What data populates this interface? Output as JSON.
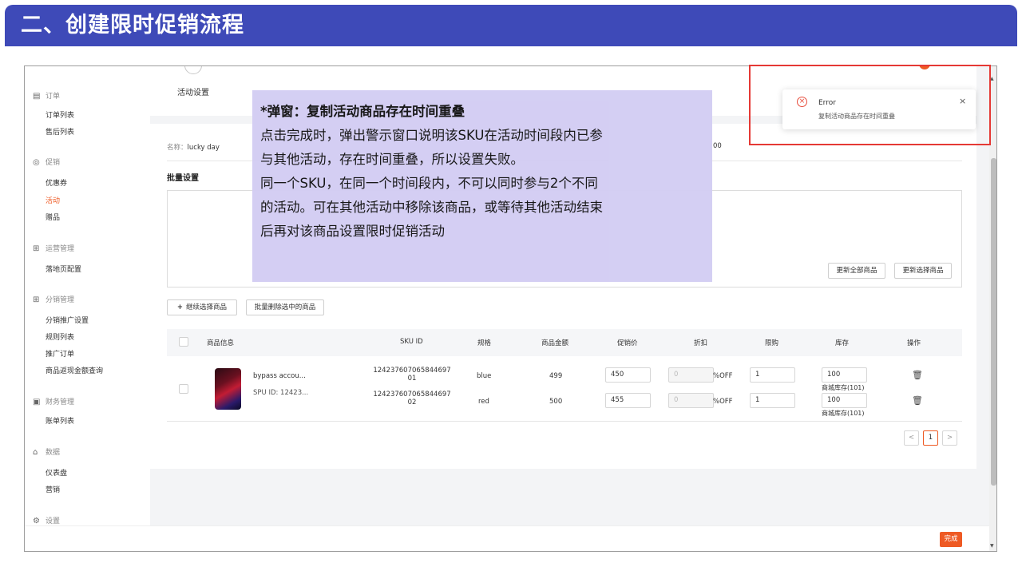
{
  "slide": {
    "title": "二、创建限时促销流程"
  },
  "sidebar": {
    "groups": [
      {
        "label": "订单",
        "icon": "clipboard-icon",
        "items": [
          {
            "label": "订单列表"
          },
          {
            "label": "售后列表"
          }
        ]
      },
      {
        "label": "促销",
        "icon": "tag-icon",
        "items": [
          {
            "label": "优惠券"
          },
          {
            "label": "活动",
            "active": true
          },
          {
            "label": "赠品"
          }
        ]
      },
      {
        "label": "运营管理",
        "icon": "grid-icon",
        "items": [
          {
            "label": "落地页配置"
          }
        ]
      },
      {
        "label": "分销管理",
        "icon": "grid-icon",
        "items": [
          {
            "label": "分销推广设置"
          },
          {
            "label": "规则列表"
          },
          {
            "label": "推广订单"
          },
          {
            "label": "商品返现金额查询"
          }
        ]
      },
      {
        "label": "财务管理",
        "icon": "ledger-icon",
        "items": [
          {
            "label": "账单列表"
          }
        ]
      },
      {
        "label": "数据",
        "icon": "chart-icon",
        "items": [
          {
            "label": "仪表盘"
          },
          {
            "label": "营销"
          }
        ]
      },
      {
        "label": "设置",
        "icon": "gear-icon",
        "items": []
      }
    ]
  },
  "steps": {
    "first": "活动设置"
  },
  "form": {
    "name_label": "名称：",
    "name_value": "lucky day",
    "name_tail": "00",
    "batch_title": "批量设置",
    "update_all": "更新全部商品",
    "update_selected": "更新选择商品",
    "continue_select": "继续选择商品",
    "batch_delete": "批量删除选中的商品"
  },
  "table": {
    "headers": [
      "商品信息",
      "SKU ID",
      "规格",
      "商品金额",
      "促销价",
      "折扣",
      "限购",
      "库存",
      "操作"
    ],
    "product": {
      "name": "bypass accou...",
      "spu": "SPU ID: 12423..."
    },
    "rows": [
      {
        "sku_line1": "124237607065844697",
        "sku_line2": "01",
        "spec": "blue",
        "price": "499",
        "promo_price": "450",
        "discount": "0",
        "discount_unit": "%OFF",
        "limit": "1",
        "stock": "100",
        "stock_note": "商城库存(101)"
      },
      {
        "sku_line1": "124237607065844697",
        "sku_line2": "02",
        "spec": "red",
        "price": "500",
        "promo_price": "455",
        "discount": "0",
        "discount_unit": "%OFF",
        "limit": "1",
        "stock": "100",
        "stock_note": "商城库存(101)"
      }
    ]
  },
  "pagination": {
    "prev": "<",
    "current": "1",
    "next": ">"
  },
  "footer": {
    "done": "完成"
  },
  "toast": {
    "title": "Error",
    "message": "复制活动商品存在时间重叠",
    "close": "×",
    "icon": "error-circle-icon",
    "color": "#e74c3c"
  },
  "callout": {
    "title": "*弹窗：复制活动商品存在时间重叠",
    "lines": [
      "点击完成时，弹出警示窗口说明该SKU在活动时间段内已参",
      "与其他活动，存在时间重叠，所以设置失败。",
      "同一个SKU，在同一个时间段内，不可以同时参与2个不同",
      "的活动。可在其他活动中移除该商品，或等待其他活动结束",
      "后再对该商品设置限时促销活动"
    ]
  },
  "colors": {
    "banner": "#3e4ab8",
    "accent": "#ee5a24",
    "highlight_frame": "#e53935",
    "callout_bg": "#d3cdf3"
  }
}
